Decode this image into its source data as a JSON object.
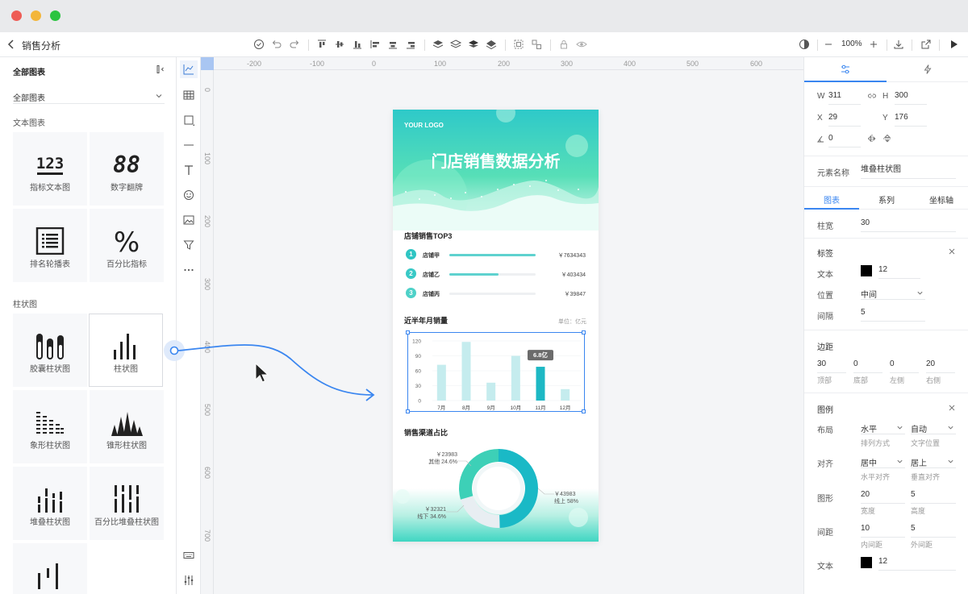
{
  "window": {
    "colors": {
      "close": "#ee5c55",
      "min": "#f3b63a",
      "max": "#2bc441"
    }
  },
  "toolbar": {
    "back_icon": "chevron-left-icon",
    "title": "销售分析",
    "zoom": "100%"
  },
  "left_panel": {
    "header": "全部图表",
    "filter_value": "全部图表",
    "sections": {
      "text": "文本图表",
      "bar": "柱状图"
    },
    "text_charts": [
      {
        "label": "指标文本图",
        "icon": "123"
      },
      {
        "label": "数字翻牌",
        "icon": "88"
      },
      {
        "label": "排名轮播表",
        "icon": "list-icon"
      },
      {
        "label": "百分比指标",
        "icon": "%"
      }
    ],
    "bar_charts": [
      {
        "label": "胶囊柱状图"
      },
      {
        "label": "柱状图"
      },
      {
        "label": "象形柱状图"
      },
      {
        "label": "锥形柱状图"
      },
      {
        "label": "堆叠柱状图"
      },
      {
        "label": "百分比堆叠柱状图"
      }
    ]
  },
  "ruler": {
    "top": [
      "-200",
      "-100",
      "0",
      "100",
      "200",
      "300",
      "400",
      "500",
      "600"
    ],
    "left": [
      "0",
      "100",
      "200",
      "300",
      "400",
      "500",
      "600",
      "700"
    ]
  },
  "phone": {
    "logo": "YOUR LOGO",
    "title": "门店销售数据分析",
    "top3_title": "店铺销售TOP3",
    "top3": [
      {
        "rank": "1",
        "name": "店铺甲",
        "value": "￥7634343",
        "fill": 1.0
      },
      {
        "rank": "2",
        "name": "店铺乙",
        "value": "￥403434",
        "fill": 0.57
      },
      {
        "rank": "3",
        "name": "店铺丙",
        "value": "￥39847",
        "fill": 0.0
      }
    ],
    "bar_title": "近半年月销量",
    "bar_unit": "单位：亿元",
    "channel_title": "销售渠道占比",
    "donut_labels": [
      {
        "value": "￥23983",
        "text": "其他  24.6%"
      },
      {
        "value": "￥32321",
        "text": "线下  34.6%"
      },
      {
        "value": "￥43983",
        "text": "线上 58%"
      }
    ]
  },
  "chart_data": {
    "type": "bar",
    "categories": [
      "7月",
      "8月",
      "9月",
      "10月",
      "11月",
      "12月"
    ],
    "values": [
      72,
      118,
      36,
      90,
      68,
      23
    ],
    "highlight_index": 4,
    "tooltip": "6.8亿",
    "yticks": [
      "120",
      "90",
      "60",
      "30",
      "0"
    ],
    "ylim": [
      0,
      120
    ],
    "colors": {
      "bar": "#c5ecee",
      "highlight": "#1db8c4"
    }
  },
  "donut_data": {
    "type": "pie",
    "values": [
      58,
      24.6,
      34.6
    ],
    "colors": [
      "#1ab9c6",
      "#e8eef2",
      "#3dd0b7"
    ]
  },
  "right_panel": {
    "tabs_icons": [
      "sliders-icon",
      "lightning-icon"
    ],
    "w_label": "W",
    "w": "311",
    "h_label": "H",
    "h": "300",
    "x_label": "X",
    "x": "29",
    "y_label": "Y",
    "y": "176",
    "angle": "0",
    "element_name_label": "元素名称",
    "element_name": "堆叠柱状图",
    "subtabs": [
      "图表",
      "系列",
      "坐标轴"
    ],
    "bar_width_label": "柱宽",
    "bar_width": "30",
    "label_section": "标签",
    "label_text_label": "文本",
    "label_text_size": "12",
    "label_position_label": "位置",
    "label_position": "中间",
    "label_gap_label": "间隔",
    "label_gap": "5",
    "margin_section": "边距",
    "margins": [
      {
        "value": "30",
        "label": "顶部"
      },
      {
        "value": "0",
        "label": "底部"
      },
      {
        "value": "0",
        "label": "左侧"
      },
      {
        "value": "20",
        "label": "右侧"
      }
    ],
    "legend_section": "图例",
    "layout_label": "布局",
    "layout_value": "水平",
    "layout_sub": "排列方式",
    "text_pos_value": "自动",
    "text_pos_sub": "文字位置",
    "align_label": "对齐",
    "align_h": "居中",
    "align_h_sub": "水平对齐",
    "align_v": "居上",
    "align_v_sub": "垂直对齐",
    "shape_label": "图形",
    "shape_w": "20",
    "shape_w_sub": "宽度",
    "shape_h": "5",
    "shape_h_sub": "高度",
    "spacing_label": "间距",
    "spacing_in": "10",
    "spacing_in_sub": "内间距",
    "spacing_out": "5",
    "spacing_out_sub": "外间距",
    "legend_text_label": "文本",
    "legend_text_size": "12"
  }
}
